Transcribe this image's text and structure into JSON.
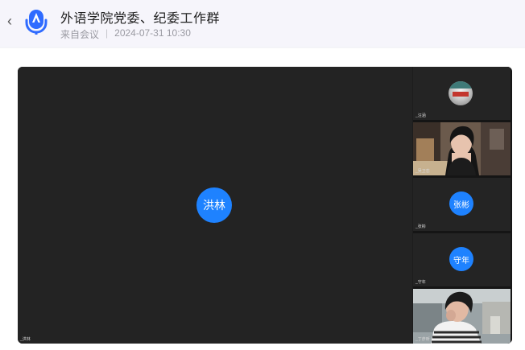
{
  "header": {
    "title": "外语学院党委、纪委工作群",
    "source": "来自会议",
    "separator": "|",
    "datetime": "2024-07-31 10:30"
  },
  "meeting": {
    "main": {
      "avatar_text": "洪林",
      "name": "_洪林"
    },
    "tiles": [
      {
        "kind": "photo-avatar",
        "name": "_汪涵"
      },
      {
        "kind": "video",
        "name": "_吴卫恋"
      },
      {
        "kind": "avatar",
        "avatar_text": "张彬",
        "name": "_张彬"
      },
      {
        "kind": "avatar",
        "avatar_text": "守年",
        "name": "_守年"
      },
      {
        "kind": "video",
        "name": "_丁彦昕"
      }
    ]
  },
  "colors": {
    "avatar_blue": "#1e82ff",
    "stage_bg": "#232323",
    "header_bg": "#f6f5fb"
  }
}
